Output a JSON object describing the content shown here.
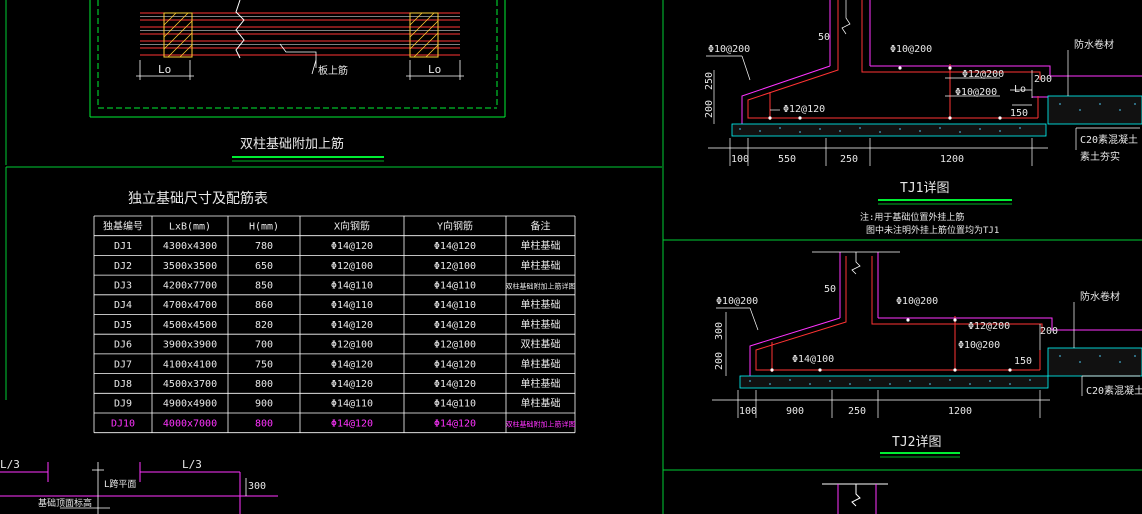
{
  "detail_left": {
    "lo_left": "Lo",
    "lo_right": "Lo",
    "rebar_note": "板上筋",
    "caption": "双柱基础附加上筋"
  },
  "table": {
    "title": "独立基础尺寸及配筋表",
    "headers": [
      "独基编号",
      "LxB(mm)",
      "H(mm)",
      "X向钢筋",
      "Y向钢筋",
      "备注"
    ],
    "rows": [
      [
        "DJ1",
        "4300x4300",
        "780",
        "Φ14@120",
        "Φ14@120",
        "单柱基础"
      ],
      [
        "DJ2",
        "3500x3500",
        "650",
        "Φ12@100",
        "Φ12@100",
        "单柱基础"
      ],
      [
        "DJ3",
        "4200x7700",
        "850",
        "Φ14@110",
        "Φ14@110",
        "双柱基础附加上筋详图"
      ],
      [
        "DJ4",
        "4700x4700",
        "860",
        "Φ14@110",
        "Φ14@110",
        "单柱基础"
      ],
      [
        "DJ5",
        "4500x4500",
        "820",
        "Φ14@120",
        "Φ14@120",
        "单柱基础"
      ],
      [
        "DJ6",
        "3900x3900",
        "700",
        "Φ12@100",
        "Φ12@100",
        "双柱基础"
      ],
      [
        "DJ7",
        "4100x4100",
        "750",
        "Φ14@120",
        "Φ14@120",
        "单柱基础"
      ],
      [
        "DJ8",
        "4500x3700",
        "800",
        "Φ14@120",
        "Φ14@120",
        "单柱基础"
      ],
      [
        "DJ9",
        "4900x4900",
        "900",
        "Φ14@110",
        "Φ14@110",
        "单柱基础"
      ],
      [
        "DJ10",
        "4000x7000",
        "800",
        "Φ14@120",
        "Φ14@120",
        "双柱基础附加上筋详图"
      ]
    ],
    "highlight_row": 9
  },
  "tj1": {
    "labels": {
      "top_bar": "Φ10@200",
      "side_bar": "Φ10@200",
      "slope_bar": "Φ12@120",
      "right_bar1": "Φ12@200",
      "right_bar2": "Φ10@200",
      "waterproof": "防水卷材",
      "concrete": "C20素混凝土",
      "soil": "素土夯实",
      "lo": "Lo",
      "d50": "50",
      "d200": "200",
      "d150": "150",
      "dim_250v": "250",
      "dim_200v": "200"
    },
    "dims": [
      "100",
      "550",
      "250",
      "1200"
    ],
    "caption": "TJ1详图",
    "note1": "注:用于基础位置外挂上筋",
    "note2": "图中未注明外挂上筋位置均为TJ1"
  },
  "tj2": {
    "labels": {
      "top_bar": "Φ10@200",
      "side_bar": "Φ10@200",
      "slope_bar": "Φ14@100",
      "right_bar1": "Φ12@200",
      "right_bar2": "Φ10@200",
      "waterproof": "防水卷材",
      "concrete": "C20素混凝土",
      "d50": "50",
      "d200": "200",
      "d150": "150",
      "dim_300v": "300",
      "dim_200v": "200"
    },
    "dims": [
      "100",
      "900",
      "250",
      "1200"
    ],
    "caption": "TJ2详图"
  },
  "bottom_left": {
    "l3_left": "L/3",
    "l3_right": "L/3",
    "d300": "300",
    "beam_note": "L跨平面",
    "elev_note": "基础顶面标高"
  }
}
